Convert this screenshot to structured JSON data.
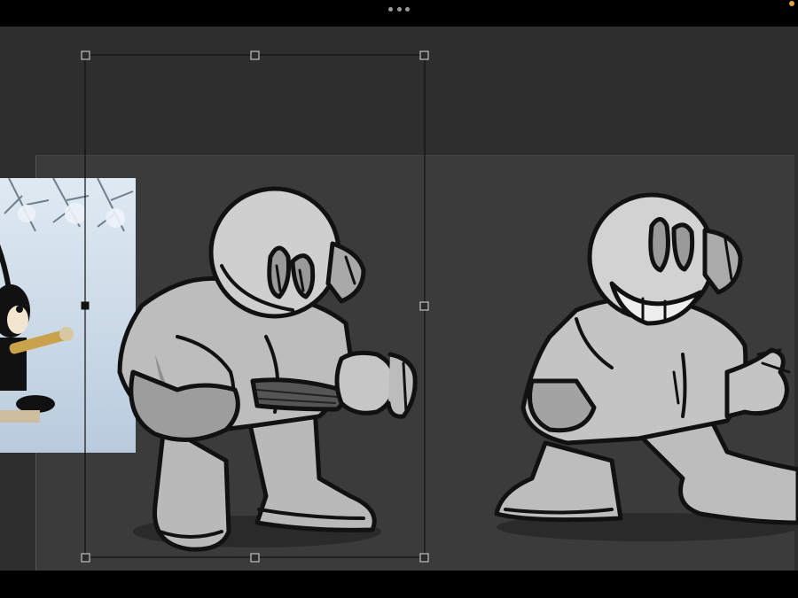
{
  "window": {
    "more_icon": "more-horizontal-icon",
    "indicator_color": "#e9a23b"
  },
  "canvas": {
    "background_color": "#2e2e2e",
    "layer_color": "#3b3b3b"
  },
  "selection": {
    "handles": [
      "top-left",
      "top-center",
      "top-right",
      "middle-left",
      "middle-right",
      "bottom-left",
      "bottom-center",
      "bottom-right"
    ]
  },
  "artwork": {
    "left_character": "character-guitar-sketch",
    "right_character": "character-grinning-sketch",
    "reference_image": "reference-cartoon-photo"
  }
}
